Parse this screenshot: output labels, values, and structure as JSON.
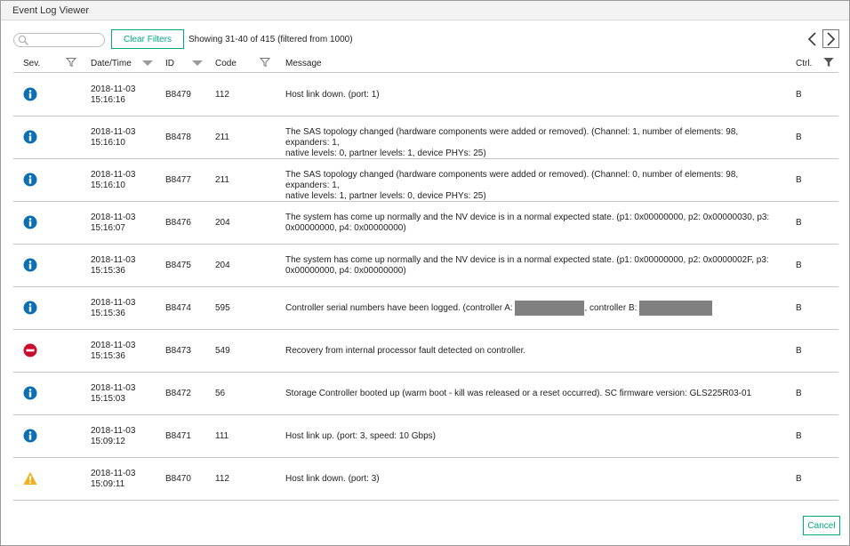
{
  "window": {
    "title": "Event Log Viewer"
  },
  "toolbar": {
    "search_placeholder": "",
    "clear_filters_label": "Clear Filters",
    "showing_text": "Showing 31-40 of 415 (filtered from 1000)"
  },
  "columns": {
    "sev": "Sev.",
    "datetime": "Date/Time",
    "id": "ID",
    "code": "Code",
    "message": "Message",
    "ctrl": "Ctrl."
  },
  "colors": {
    "accent": "#01a982",
    "info": "#0d6eb4",
    "error": "#c8102e",
    "warning": "#f2b01e"
  },
  "rows": [
    {
      "severity": "info-icon",
      "date": "2018-11-03",
      "time": "15:16:16",
      "id": "B8479",
      "code": "112",
      "message": "Host link down. (port: 1)",
      "message2": "",
      "ctrl": "B"
    },
    {
      "severity": "info-icon",
      "date": "2018-11-03",
      "time": "15:16:10",
      "id": "B8478",
      "code": "211",
      "message": "The SAS topology changed (hardware components were added or removed). (Channel: 1, number of elements: 98, expanders: 1,",
      "message2": "native levels: 0, partner levels: 1, device PHYs: 25)",
      "ctrl": "B"
    },
    {
      "severity": "info-icon",
      "date": "2018-11-03",
      "time": "15:16:10",
      "id": "B8477",
      "code": "211",
      "message": "The SAS topology changed (hardware components were added or removed). (Channel: 0, number of elements: 98, expanders: 1,",
      "message2": "native levels: 1, partner levels: 0, device PHYs: 25)",
      "ctrl": "B"
    },
    {
      "severity": "info-icon",
      "date": "2018-11-03",
      "time": "15:16:07",
      "id": "B8476",
      "code": "204",
      "message": "The system has come up normally and the NV device is in a normal expected state. (p1: 0x00000000, p2: 0x00000030, p3:",
      "message2": "0x00000000, p4: 0x00000000)",
      "ctrl": "B"
    },
    {
      "severity": "info-icon",
      "date": "2018-11-03",
      "time": "15:15:36",
      "id": "B8475",
      "code": "204",
      "message": "The system has come up normally and the NV device is in a normal expected state. (p1: 0x00000000, p2: 0x0000002F, p3:",
      "message2": "0x00000000, p4: 0x00000000)",
      "ctrl": "B"
    },
    {
      "severity": "info-icon",
      "date": "2018-11-03",
      "time": "15:15:36",
      "id": "B8474",
      "code": "595",
      "message": "Controller serial numbers have been logged. (controller A: ",
      "message_mid": ", controller B: ",
      "ctrl": "B"
    },
    {
      "severity": "error-icon",
      "date": "2018-11-03",
      "time": "15:15:36",
      "id": "B8473",
      "code": "549",
      "message": "Recovery from internal processor fault detected on controller.",
      "message2": "",
      "ctrl": "B"
    },
    {
      "severity": "info-icon",
      "date": "2018-11-03",
      "time": "15:15:03",
      "id": "B8472",
      "code": "56",
      "message": "Storage Controller booted up (warm boot - kill was released or a reset occurred). SC firmware version: GLS225R03-01",
      "message2": "",
      "ctrl": "B"
    },
    {
      "severity": "info-icon",
      "date": "2018-11-03",
      "time": "15:09:12",
      "id": "B8471",
      "code": "111",
      "message": "Host link up. (port: 3, speed: 10 Gbps)",
      "message2": "",
      "ctrl": "B"
    },
    {
      "severity": "warning-icon",
      "date": "2018-11-03",
      "time": "15:09:11",
      "id": "B8470",
      "code": "112",
      "message": "Host link down. (port: 3)",
      "message2": "",
      "ctrl": "B"
    }
  ],
  "footer": {
    "cancel_label": "Cancel"
  }
}
